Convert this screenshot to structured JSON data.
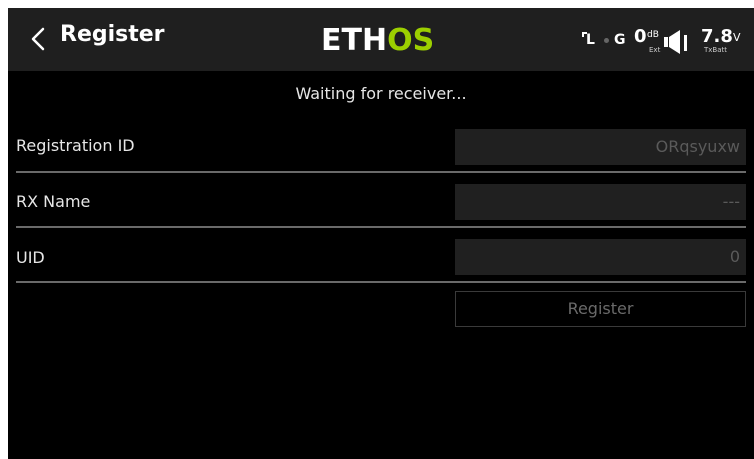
{
  "header": {
    "title": "Register",
    "logo_prefix": "ETH",
    "logo_suffix": "OS",
    "logo_accent_color": "#9ccf00",
    "status": {
      "l_label": "L",
      "g_label": "G",
      "db_value": "0",
      "db_unit": "dB",
      "ext_label": "Ext",
      "voltage_value": "7.8",
      "voltage_unit": "V",
      "txbatt_label": "TxBatt"
    }
  },
  "status_message": "Waiting for receiver...",
  "fields": {
    "registration_id": {
      "label": "Registration ID",
      "value": "ORqsyuxw"
    },
    "rx_name": {
      "label": "RX Name",
      "value": "---"
    },
    "uid": {
      "label": "UID",
      "value": "0"
    }
  },
  "register_button": {
    "label": "Register"
  },
  "icons": {
    "back": "chevron-left-icon",
    "speaker": "speaker-icon"
  }
}
